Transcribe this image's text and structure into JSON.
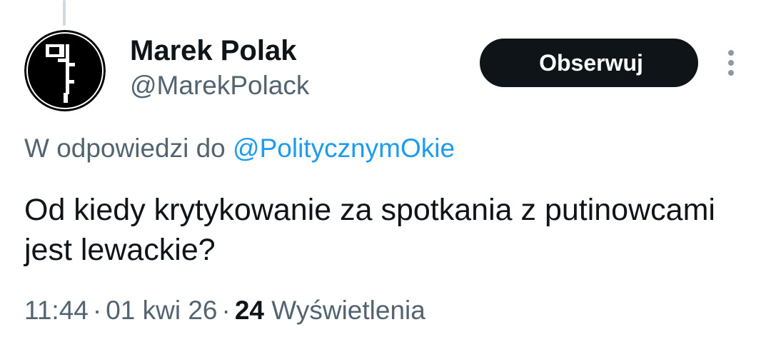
{
  "tweet": {
    "author": {
      "display_name": "Marek Polak",
      "handle": "@MarekPolack",
      "avatar_icon": "bauhaus-logo-icon"
    },
    "follow_label": "Obserwuj",
    "more_icon": "more-vertical-icon",
    "reply_context": {
      "prefix": "W odpowiedzi do",
      "mention": "@PolitycznymOkie"
    },
    "text": "Od kiedy krytykowanie za spotkania z putinowcami jest lewackie?",
    "meta": {
      "time": "11:44",
      "separator": "·",
      "date": "01 kwi 26",
      "views_count": "24",
      "views_label": "Wyświetlenia"
    },
    "colors": {
      "text": "#0f1419",
      "secondary": "#536471",
      "link": "#1d9bf0",
      "button_bg": "#0f1419",
      "button_text": "#ffffff",
      "thread_line": "#cfd9de"
    }
  }
}
